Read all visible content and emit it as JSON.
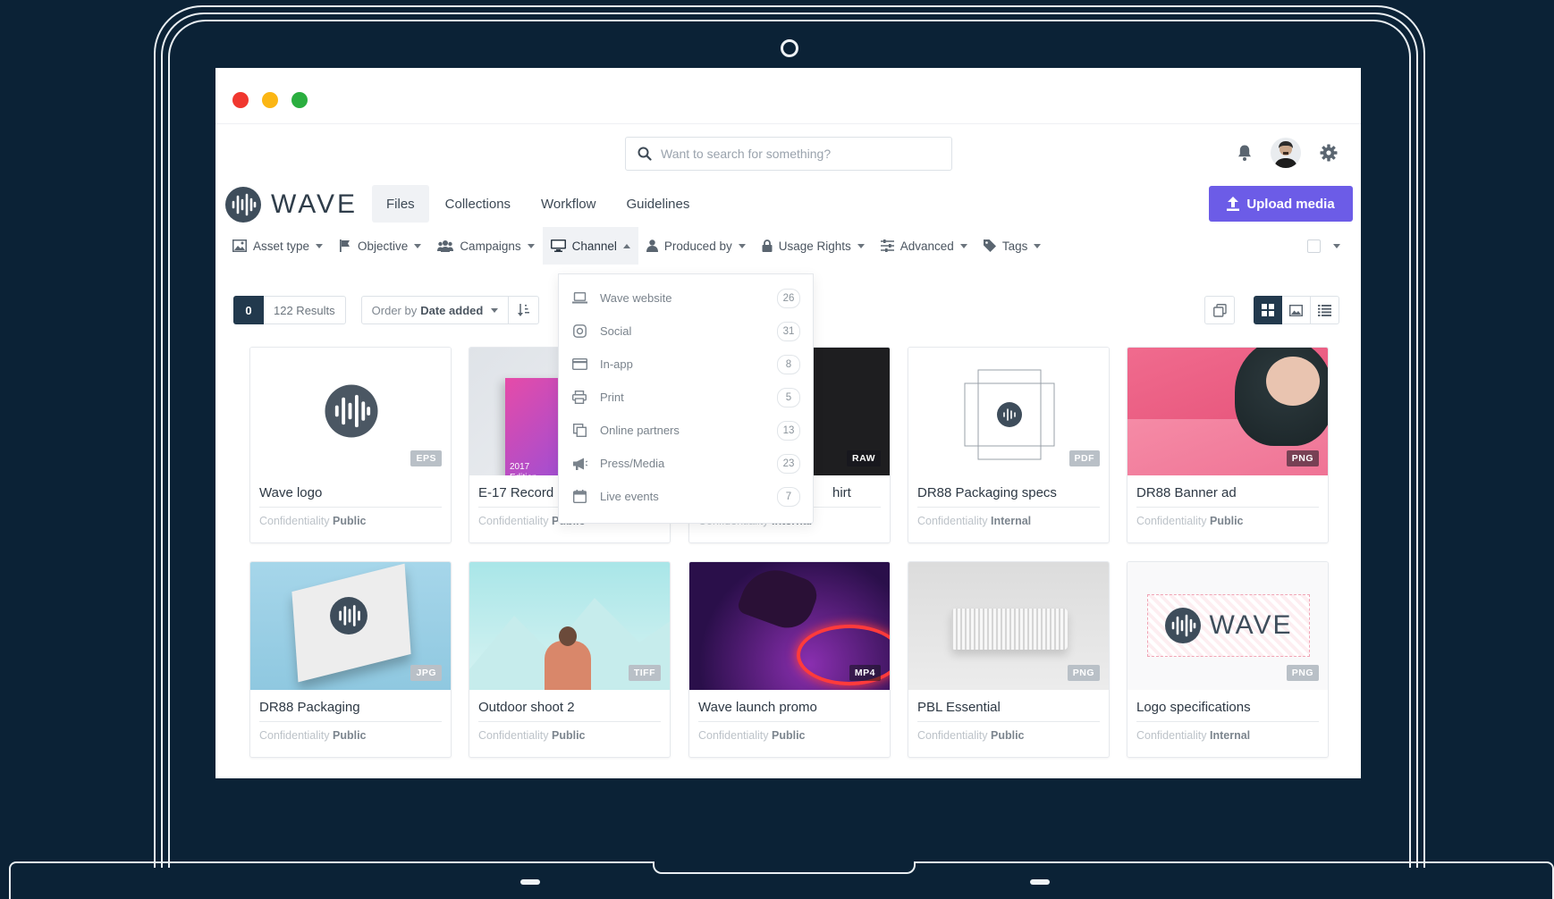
{
  "search": {
    "placeholder": "Want to search for something?"
  },
  "brand": {
    "name": "WAVE"
  },
  "nav": {
    "tabs": [
      {
        "label": "Files",
        "active": true
      },
      {
        "label": "Collections"
      },
      {
        "label": "Workflow"
      },
      {
        "label": "Guidelines"
      }
    ]
  },
  "upload": {
    "label": "Upload media"
  },
  "filters": [
    {
      "label": "Asset type",
      "icon": "image-icon"
    },
    {
      "label": "Objective",
      "icon": "flag-icon"
    },
    {
      "label": "Campaigns",
      "icon": "users-icon"
    },
    {
      "label": "Channel",
      "icon": "monitor-icon",
      "active": true
    },
    {
      "label": "Produced by",
      "icon": "user-icon"
    },
    {
      "label": "Usage Rights",
      "icon": "lock-icon"
    },
    {
      "label": "Advanced",
      "icon": "sliders-icon"
    },
    {
      "label": "Tags",
      "icon": "tag-icon"
    }
  ],
  "results": {
    "count": "0",
    "label": "122 Results",
    "order_prefix": "Order by",
    "order_value": "Date added"
  },
  "channel_menu": [
    {
      "label": "Wave website",
      "count": "26",
      "icon": "laptop-icon"
    },
    {
      "label": "Social",
      "count": "31",
      "icon": "instagram-icon"
    },
    {
      "label": "In-app",
      "count": "8",
      "icon": "credit-card-icon"
    },
    {
      "label": "Print",
      "count": "5",
      "icon": "printer-icon"
    },
    {
      "label": "Online partners",
      "count": "13",
      "icon": "copy-icon"
    },
    {
      "label": "Press/Media",
      "count": "23",
      "icon": "megaphone-icon"
    },
    {
      "label": "Live events",
      "count": "7",
      "icon": "calendar-icon"
    }
  ],
  "confidentiality_label": "Confidentiality",
  "cards": [
    {
      "name": "Wave logo",
      "type": "EPS",
      "confidentiality": "Public"
    },
    {
      "name": "E-17 Record",
      "type": "",
      "confidentiality": "Public",
      "edition": "2017 Edition"
    },
    {
      "name": "hirt",
      "type": "RAW",
      "confidentiality": "Internal"
    },
    {
      "name": "DR88 Packaging specs",
      "type": "PDF",
      "confidentiality": "Internal"
    },
    {
      "name": "DR88 Banner ad",
      "type": "PNG",
      "confidentiality": "Public"
    },
    {
      "name": "DR88 Packaging",
      "type": "JPG",
      "confidentiality": "Public"
    },
    {
      "name": "Outdoor shoot 2",
      "type": "TIFF",
      "confidentiality": "Public"
    },
    {
      "name": "Wave launch promo",
      "type": "MP4",
      "confidentiality": "Public"
    },
    {
      "name": "PBL Essential",
      "type": "PNG",
      "confidentiality": "Public"
    },
    {
      "name": "Logo specifications",
      "type": "PNG",
      "confidentiality": "Internal"
    }
  ],
  "colors": {
    "accent": "#6c5ce7",
    "navy": "#22394d",
    "background": "#0b2236"
  }
}
